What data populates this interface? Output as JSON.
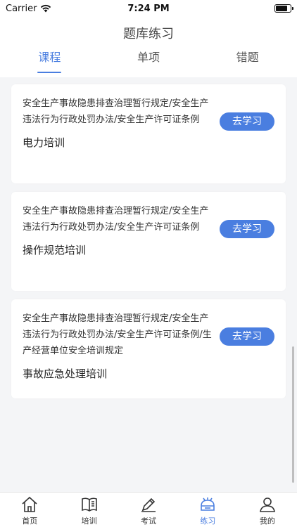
{
  "status_bar": {
    "carrier": "Carrier",
    "time": "7:24 PM"
  },
  "header": {
    "title": "题库练习",
    "tabs": [
      {
        "label": "课程",
        "active": true
      },
      {
        "label": "单项",
        "active": false
      },
      {
        "label": "错题",
        "active": false
      }
    ]
  },
  "courses": [
    {
      "description": "安全生产事故隐患排查治理暂行规定/安全生产违法行为行政处罚办法/安全生产许可证条例",
      "title": "电力培训",
      "button_label": "去学习"
    },
    {
      "description": "安全生产事故隐患排查治理暂行规定/安全生产违法行为行政处罚办法/安全生产许可证条例",
      "title": "操作规范培训",
      "button_label": "去学习"
    },
    {
      "description": "安全生产事故隐患排查治理暂行规定/安全生产违法行为行政处罚办法/安全生产许可证条例/生产经营单位安全培训规定",
      "title": "事故应急处理培训",
      "button_label": "去学习"
    }
  ],
  "tabbar": {
    "items": [
      {
        "label": "首页",
        "icon": "home-icon"
      },
      {
        "label": "培训",
        "icon": "book-icon"
      },
      {
        "label": "考试",
        "icon": "pen-icon"
      },
      {
        "label": "练习",
        "icon": "practice-icon",
        "active": true
      },
      {
        "label": "我的",
        "icon": "user-icon"
      }
    ]
  },
  "colors": {
    "accent": "#4a7ee0",
    "background": "#f4f5f7"
  }
}
